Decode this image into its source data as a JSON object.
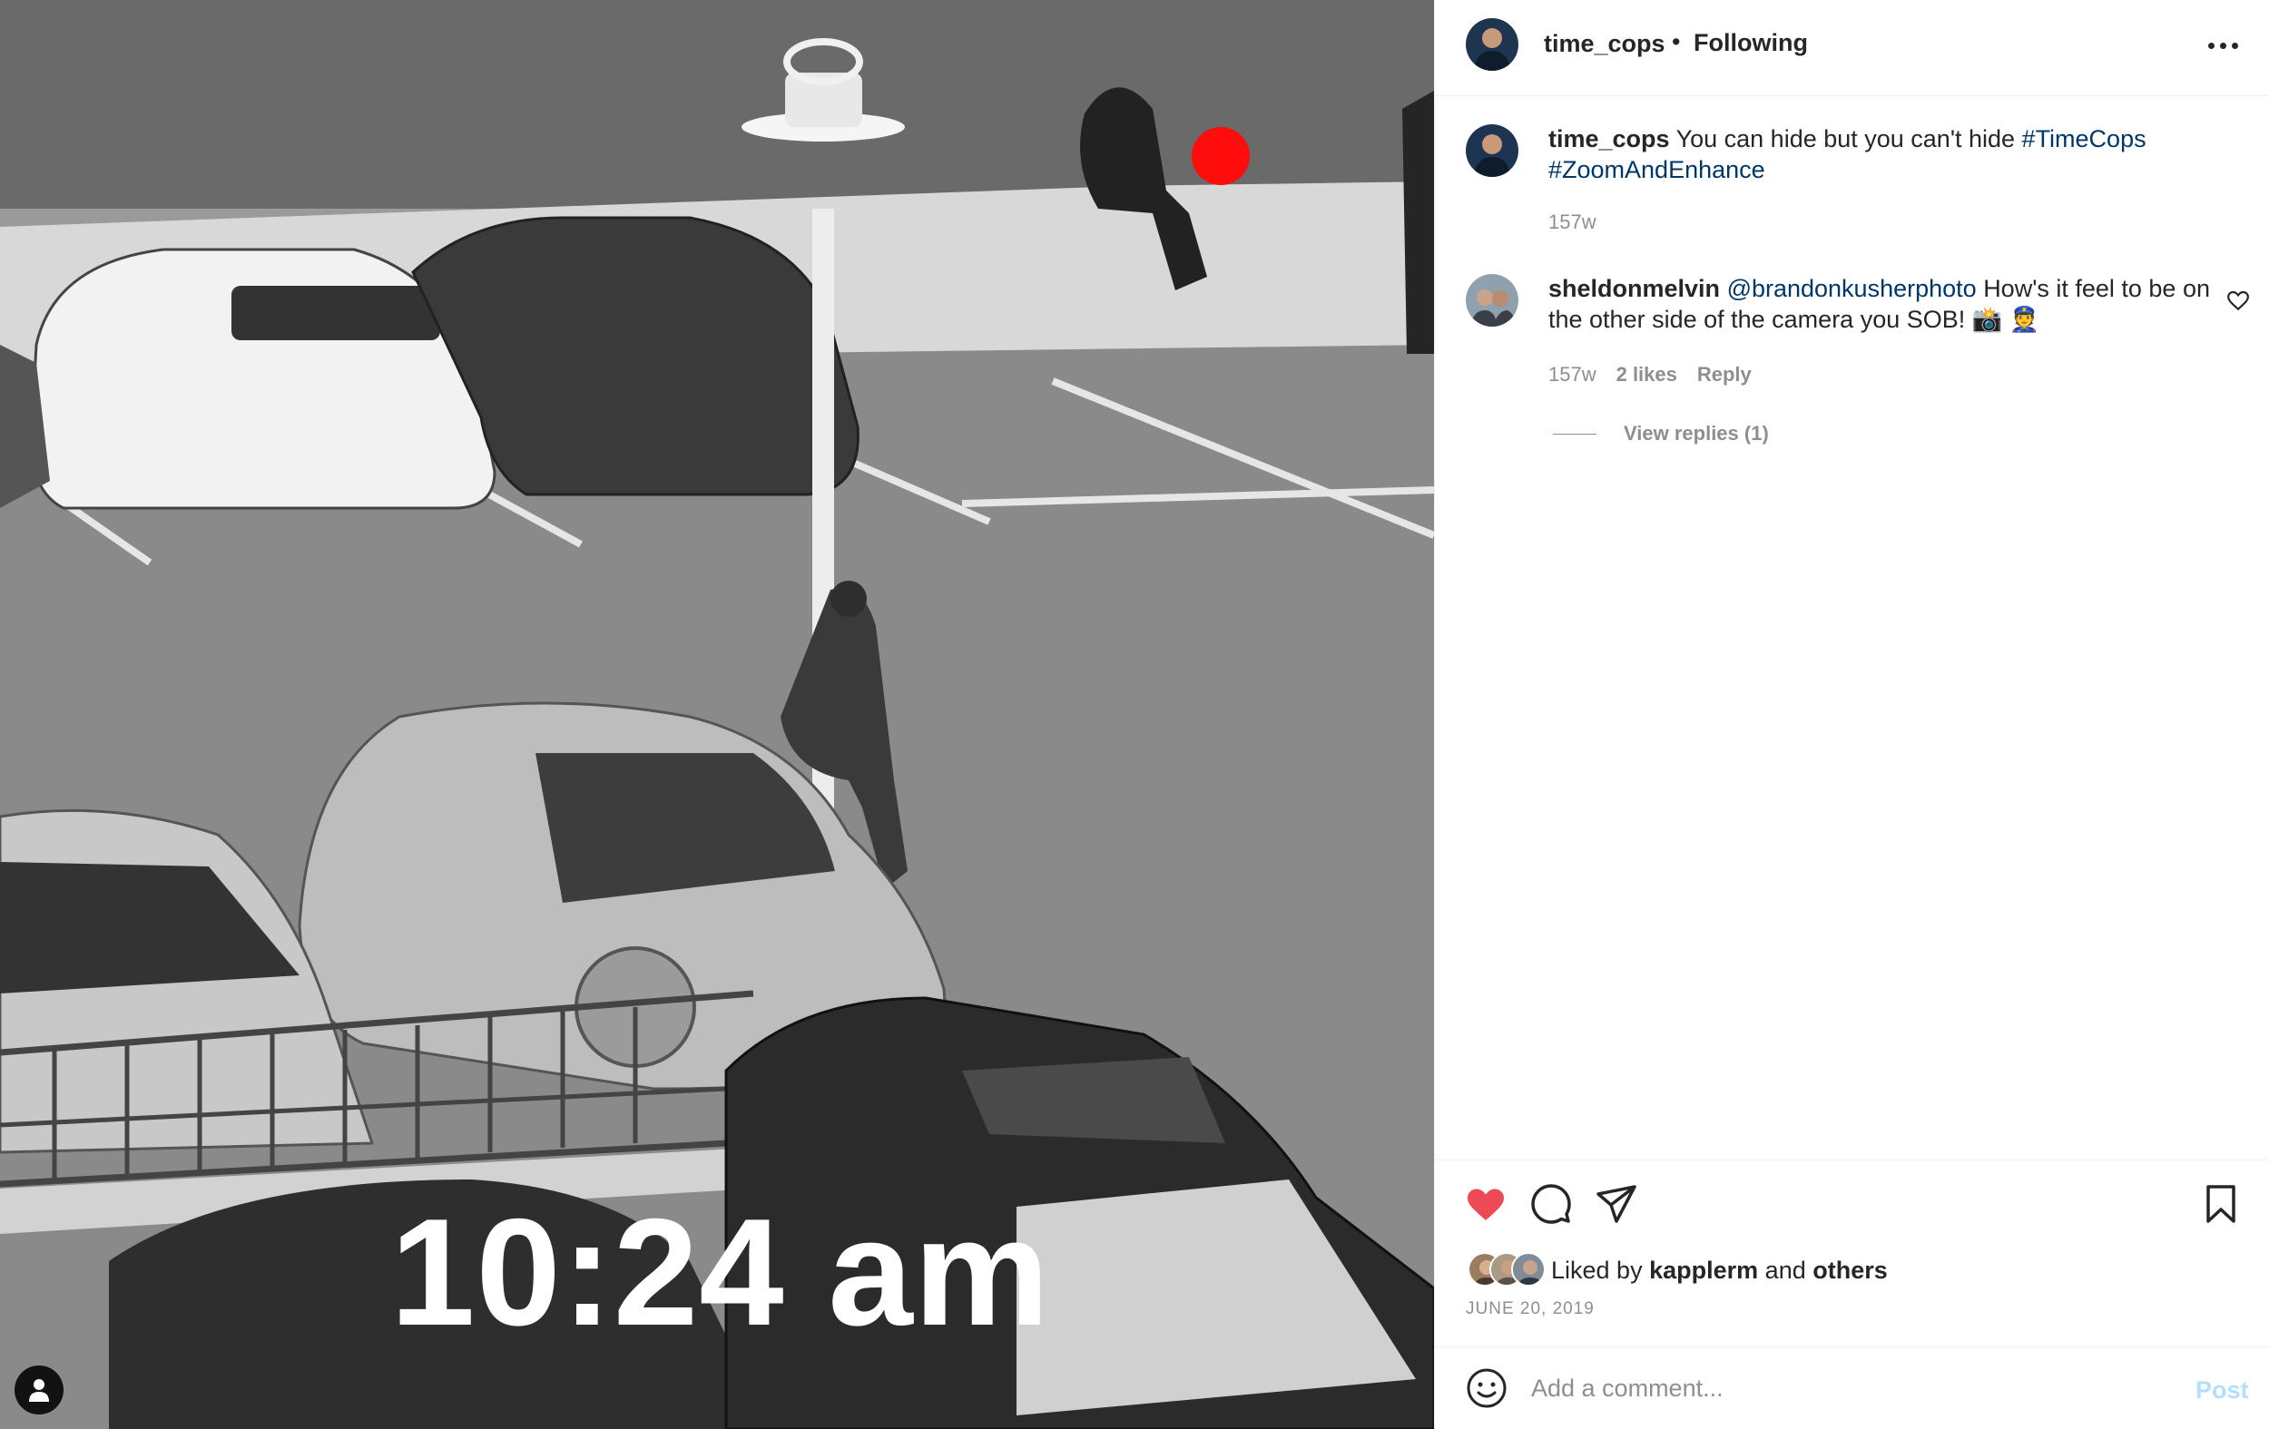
{
  "media": {
    "overlay_text": "10:24 am",
    "rec_dot_color": "#ff0c0c"
  },
  "header": {
    "username": "time_cops",
    "separator": "•",
    "follow_status": "Following",
    "more_icon": "more-horizontal-icon"
  },
  "caption": {
    "username": "time_cops",
    "text": "You can hide but you can't hide",
    "hashtags": [
      "#TimeCops",
      "#ZoomAndEnhance"
    ],
    "time": "157w"
  },
  "comments": [
    {
      "username": "sheldonmelvin",
      "mention": "@brandonkusherphoto",
      "text": "How's it feel to be on the other side of the camera you SOB! 📸 👮",
      "time": "157w",
      "likes": "2 likes",
      "reply_label": "Reply",
      "view_replies": "View replies (1)"
    }
  ],
  "actions": {
    "liked": true,
    "like_color": "#ed4956",
    "icons": [
      "heart-icon",
      "comment-icon",
      "share-icon",
      "bookmark-icon"
    ]
  },
  "likes": {
    "prefix": "Liked by",
    "user": "kapplerm",
    "joiner": "and",
    "suffix": "others"
  },
  "post_date": "JUNE 20, 2019",
  "comment_box": {
    "placeholder": "Add a comment...",
    "post_label": "Post",
    "post_color": "#b2dffc"
  },
  "colors": {
    "link": "#00376b",
    "muted": "#8e8e8e",
    "text": "#262626"
  }
}
